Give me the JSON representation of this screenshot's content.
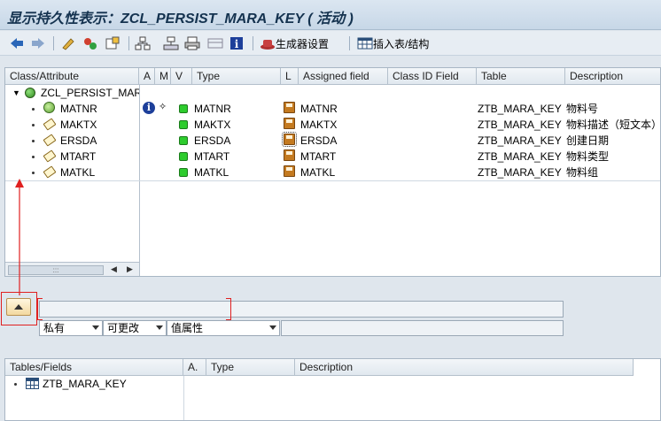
{
  "window": {
    "title": "显示持久性表示：ZCL_PERSIST_MARA_KEY ( 活动 )"
  },
  "toolbar": {
    "generator_settings": "生成器设置",
    "insert_table": "插入表/结构"
  },
  "mapping_table": {
    "columns": [
      "Class/Attribute",
      "A",
      "M",
      "V",
      "Type",
      "L",
      "Assigned field",
      "Class ID Field",
      "Table",
      "Description"
    ],
    "root": "ZCL_PERSIST_MARA_KEY",
    "rows": [
      {
        "name": "MATNR",
        "type": "MATNR",
        "assigned": "MATNR",
        "table": "ZTB_MARA_KEY",
        "desc": "物料号"
      },
      {
        "name": "MAKTX",
        "type": "MAKTX",
        "assigned": "MAKTX",
        "table": "ZTB_MARA_KEY",
        "desc": "物料描述（短文本）"
      },
      {
        "name": "ERSDA",
        "type": "ERSDA",
        "assigned": "ERSDA",
        "table": "ZTB_MARA_KEY",
        "desc": "创建日期"
      },
      {
        "name": "MTART",
        "type": "MTART",
        "assigned": "MTART",
        "table": "ZTB_MARA_KEY",
        "desc": "物料类型"
      },
      {
        "name": "MATKL",
        "type": "MATKL",
        "assigned": "MATKL",
        "table": "ZTB_MARA_KEY",
        "desc": "物料组"
      }
    ],
    "scroll_grip": ":::"
  },
  "editor": {
    "visibility": "私有",
    "accessibility": "可更改",
    "attr_kind": "值属性",
    "name_value": "",
    "desc_value": ""
  },
  "fields_table": {
    "columns": [
      "Tables/Fields",
      "A.",
      "Type",
      "Description"
    ],
    "rows": [
      {
        "name": "ZTB_MARA_KEY"
      }
    ]
  },
  "colors": {
    "annotation_red": "#e02020",
    "accent_green": "#2ecc2e"
  }
}
